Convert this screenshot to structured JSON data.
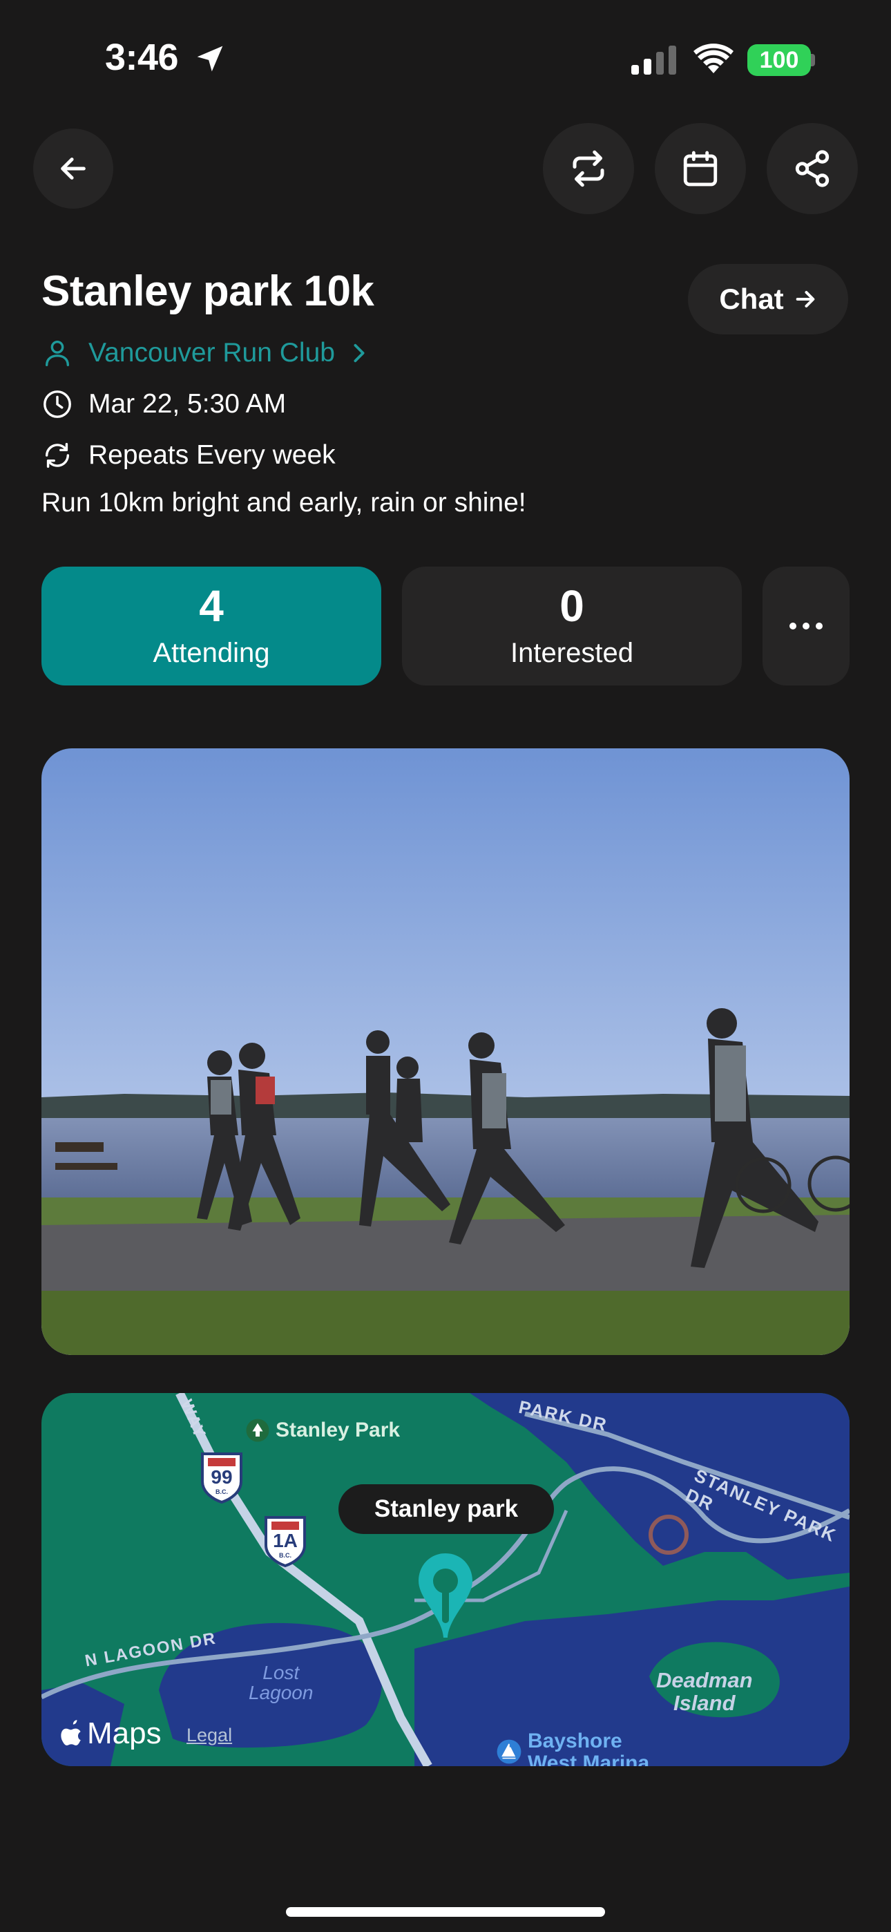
{
  "status_bar": {
    "time": "3:46",
    "battery": "100"
  },
  "toolbar": {
    "icons": [
      "back-arrow-icon",
      "repeat-icon",
      "calendar-icon",
      "share-icon"
    ]
  },
  "event": {
    "title": "Stanley park 10k",
    "chat_label": "Chat",
    "club": "Vancouver Run Club",
    "datetime": "Mar 22, 5:30 AM",
    "repeat": "Repeats Every week",
    "description": "Run 10km bright and early, rain or shine!"
  },
  "stats": {
    "attending": {
      "count": "4",
      "label": "Attending"
    },
    "interested": {
      "count": "0",
      "label": "Interested"
    },
    "more_label": "..."
  },
  "map": {
    "pin_label": "Stanley park",
    "poi_stanley": "Stanley Park",
    "road_park_dr": "PARK DR",
    "road_stanley_park_dr": "STANLEY PARK DR",
    "road_lagoon": "N LAGOON DR",
    "road_way": "WAY",
    "lost_lagoon_1": "Lost",
    "lost_lagoon_2": "Lagoon",
    "deadman_1": "Deadman",
    "deadman_2": "Island",
    "bayshore_1": "Bayshore",
    "bayshore_2": "West Marina",
    "shield_99": "99",
    "shield_1a": "1A",
    "shield_bc": "B.C.",
    "maps_brand": "Maps",
    "legal": "Legal"
  },
  "colors": {
    "background": "#1a1919",
    "card": "#262525",
    "accent": "#048a8a",
    "link": "#1f9a9b",
    "map_green": "#0f7a60",
    "map_water": "#223a8c"
  }
}
